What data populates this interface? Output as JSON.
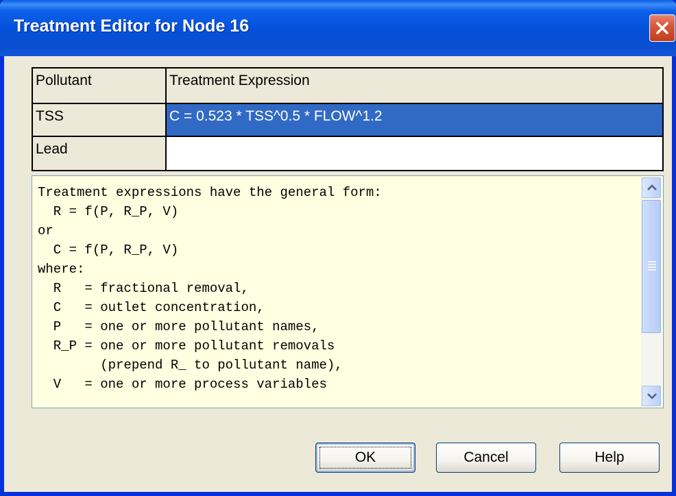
{
  "window": {
    "title": "Treatment Editor for Node 16",
    "close_icon": "close-icon"
  },
  "grid": {
    "headers": [
      "Pollutant",
      "Treatment Expression"
    ],
    "rows": [
      {
        "pollutant": "TSS",
        "expression": "C = 0.523 * TSS^0.5 * FLOW^1.2",
        "selected": true
      },
      {
        "pollutant": "Lead",
        "expression": "",
        "selected": false
      }
    ],
    "selected_color": "#316ac5"
  },
  "help": {
    "lines": [
      "Treatment expressions have the general form:",
      "  R = f(P, R_P, V)",
      "or",
      "  C = f(P, R_P, V)",
      "where:",
      "  R   = fractional removal,",
      "  C   = outlet concentration,",
      "  P   = one or more pollutant names,",
      "  R_P = one or more pollutant removals",
      "        (prepend R_ to pollutant name),",
      "  V   = one or more process variables"
    ],
    "background": "#ffffe1"
  },
  "buttons": {
    "ok": "OK",
    "cancel": "Cancel",
    "help": "Help"
  }
}
